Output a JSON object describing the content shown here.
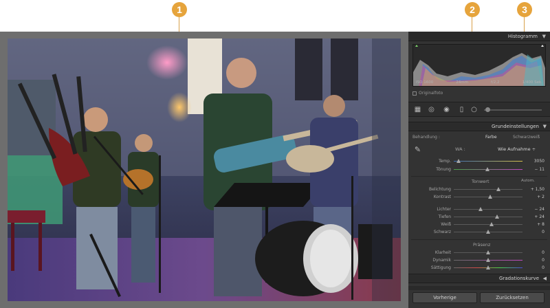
{
  "callouts": [
    "1",
    "2",
    "3"
  ],
  "panel": {
    "histogram_title": "Histogramm",
    "hist_info": {
      "iso": "ISO 1600",
      "focal": "24mm",
      "aperture": "f/2,2",
      "shutter": "1/400 Sek."
    },
    "original_photo": "Originalfoto",
    "basic_title": "Grundeinstellungen",
    "treatment_label": "Behandlung :",
    "treatment_color": "Farbe",
    "treatment_bw": "Schwarzweiß",
    "wb_label": "WA :",
    "wb_value": "Wie Aufnahme ÷",
    "temp_label": "Temp.",
    "temp_value": "3050",
    "tint_label": "Tönung",
    "tint_value": "− 11",
    "tone_title": "Tonwert",
    "auto_label": "Autom.",
    "exposure_label": "Belichtung",
    "exposure_value": "+ 1,50",
    "contrast_label": "Kontrast",
    "contrast_value": "+ 2",
    "highlights_label": "Lichter",
    "highlights_value": "− 24",
    "shadows_label": "Tiefen",
    "shadows_value": "+ 24",
    "whites_label": "Weiß",
    "whites_value": "+ 8",
    "blacks_label": "Schwarz",
    "blacks_value": "0",
    "presence_title": "Präsenz",
    "clarity_label": "Klarheit",
    "clarity_value": "0",
    "vibrance_label": "Dynamik",
    "vibrance_value": "0",
    "saturation_label": "Sättigung",
    "saturation_value": "0",
    "tone_curve_title": "Gradationskurve",
    "previous_button": "Vorherige",
    "reset_button": "Zurücksetzen"
  },
  "colors": {
    "accent": "#e6a43c",
    "panel_bg": "#333333",
    "frame": "#6e6e6e"
  }
}
